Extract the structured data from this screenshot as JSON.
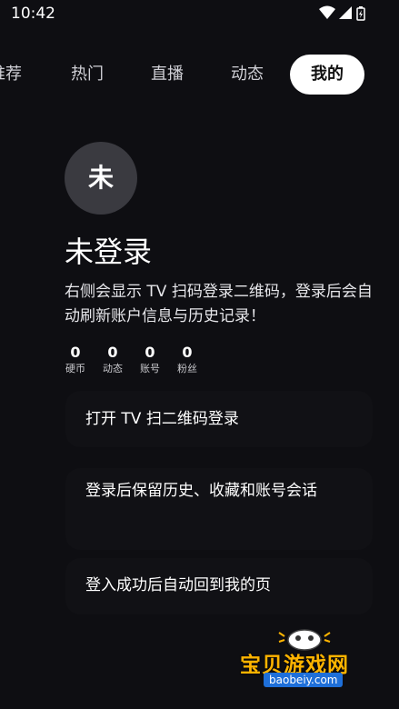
{
  "status_bar": {
    "time": "10:42"
  },
  "tabs": [
    {
      "label": "推荐"
    },
    {
      "label": "热门"
    },
    {
      "label": "直播"
    },
    {
      "label": "动态"
    },
    {
      "label": "我的",
      "active": true
    }
  ],
  "profile": {
    "avatar_char": "未",
    "name": "未登录",
    "description": "右侧会显示 TV 扫码登录二维码，登录后会自动刷新账户信息与历史记录！",
    "stats": [
      {
        "value": "0",
        "label": "硬币"
      },
      {
        "value": "0",
        "label": "动态"
      },
      {
        "value": "0",
        "label": "账号"
      },
      {
        "value": "0",
        "label": "粉丝"
      }
    ]
  },
  "actions": [
    {
      "label": "打开 TV 扫二维码登录"
    },
    {
      "label": "登录后保留历史、收藏和账号会话"
    },
    {
      "label": "登入成功后自动回到我的页"
    }
  ],
  "watermark": {
    "title": "宝贝游戏网",
    "url": "baobeiy.com"
  },
  "colors": {
    "background": "#0e0e12",
    "active_tab_bg": "#ffffff",
    "avatar_bg": "#3a3a40"
  }
}
